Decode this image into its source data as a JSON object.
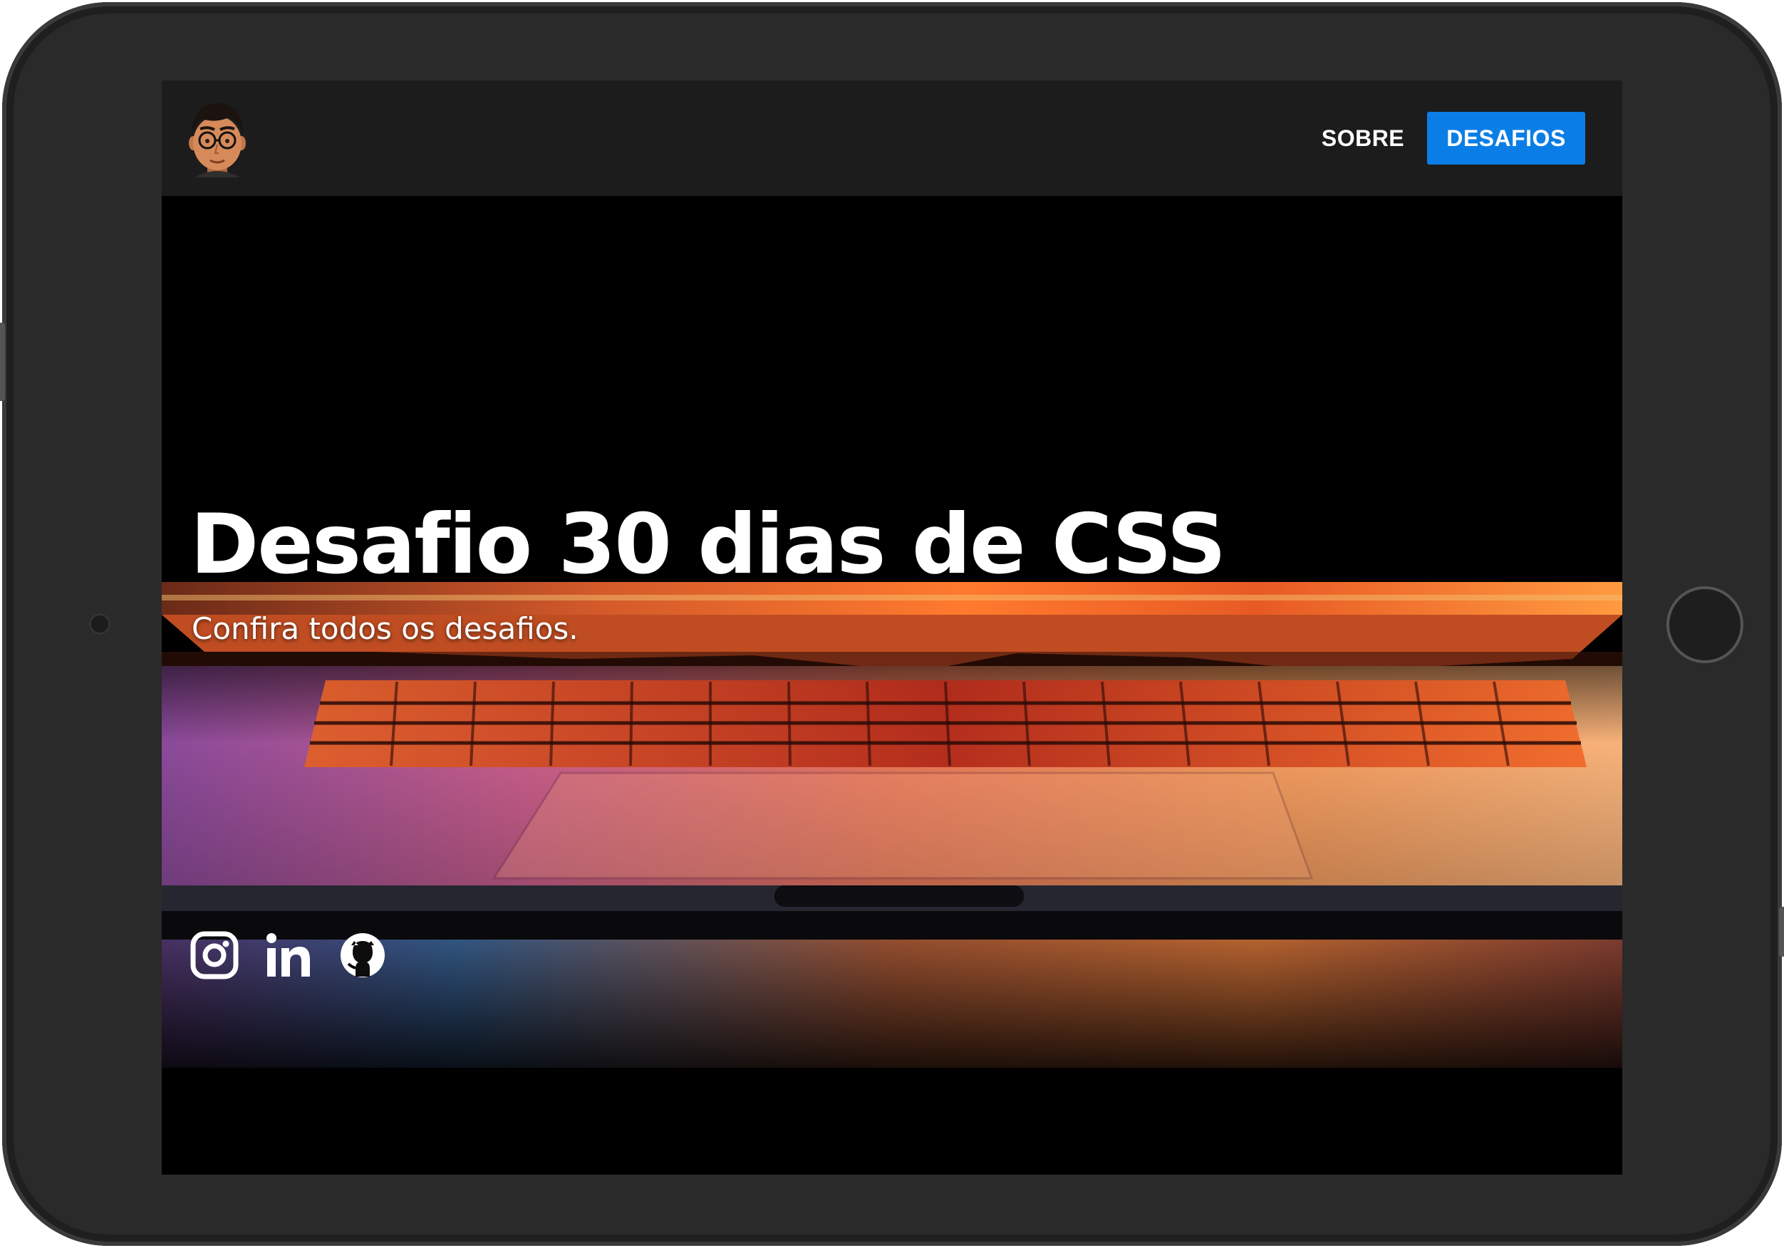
{
  "header": {
    "avatar_icon": "developer-avatar-with-glasses",
    "nav": [
      {
        "label": "SOBRE",
        "active": false
      },
      {
        "label": "DESAFIOS",
        "active": true
      }
    ]
  },
  "hero": {
    "title": "Desafio 30 dias de CSS",
    "subtitle": "Confira todos os desafios.",
    "background_image": "laptop-keyboard-orange-glow"
  },
  "social": [
    {
      "icon": "instagram-icon"
    },
    {
      "icon": "linkedin-icon"
    },
    {
      "icon": "github-icon"
    }
  ],
  "colors": {
    "accent": "#0a7ee6",
    "navbar": "#1c1c1c",
    "background": "#000000",
    "text": "#ffffff"
  }
}
